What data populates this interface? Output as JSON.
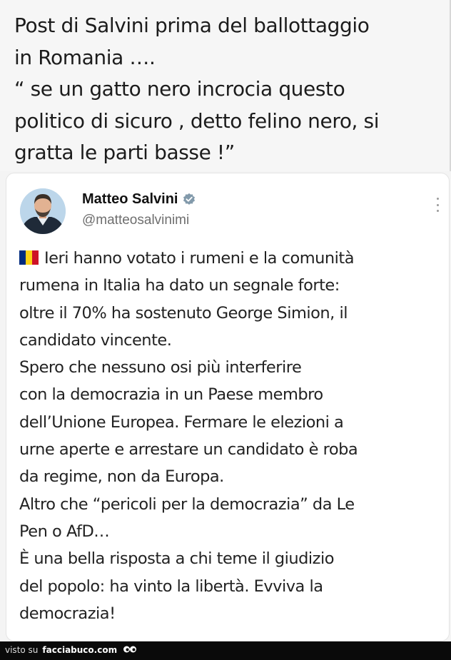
{
  "caption": {
    "lines": [
      "Post di Salvini prima del ballottaggio",
      "in Romania ….",
      "“ se un gatto nero incrocia questo",
      "politico di sicuro , detto felino nero, si",
      "gratta le parti basse !”"
    ]
  },
  "tweet": {
    "author_name": "Matteo Salvini",
    "handle": "@matteosalvinimi",
    "flag_colors": [
      "#002B7F",
      "#FCD116",
      "#CE1126"
    ],
    "verified_color": "#829aab",
    "lines": [
      "Ieri hanno votato i rumeni e la comunità",
      "rumena in Italia ha dato un segnale forte:",
      "oltre il 70% ha sostenuto George Simion, il",
      "candidato vincente.",
      "Spero che nessuno osi più interferire",
      "con la democrazia in un Paese membro",
      "dell’Unione Europea. Fermare le elezioni a",
      "urne aperte e arrestare un candidato è roba",
      "da regime, non da Europa.",
      "Altro che “pericoli per la democrazia” da Le",
      "Pen o AfD…",
      "È una bella risposta a chi teme il giudizio",
      "del popolo: ha vinto la libertà. Evviva la",
      "democrazia!"
    ]
  },
  "footer": {
    "prefix": "visto su",
    "site": "facciabuco.com"
  }
}
